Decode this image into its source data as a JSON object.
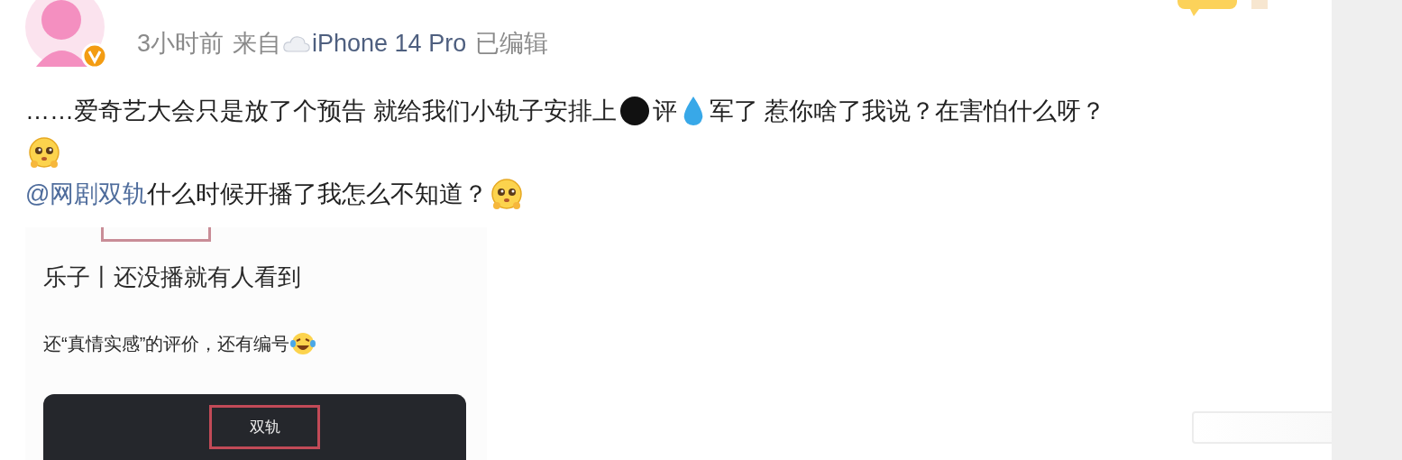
{
  "post": {
    "meta": {
      "time": "3小时前",
      "source_label": "来自",
      "device": "iPhone 14 Pro",
      "edited": "已编辑"
    },
    "lines": [
      {
        "segments": [
          {
            "kind": "text",
            "text": "……爱奇艺大会只是放了个预告 就给我们小轨子安排上"
          },
          {
            "kind": "dot"
          },
          {
            "kind": "text",
            "text": "评"
          },
          {
            "kind": "drop"
          },
          {
            "kind": "text",
            "text": "军了 惹你啥了我说？在害怕什么呀？"
          }
        ]
      },
      {
        "segments": [
          {
            "kind": "face"
          }
        ]
      },
      {
        "segments": [
          {
            "kind": "mention",
            "text": "@网剧双轨"
          },
          {
            "kind": "text",
            "text": " 什么时候开播了我怎么不知道？ "
          },
          {
            "kind": "face"
          }
        ]
      }
    ],
    "attached_image": {
      "title": "乐子丨还没播就有人看到",
      "caption": "还“真情实感”的评价，还有编号",
      "card_tab": "双轨"
    }
  }
}
